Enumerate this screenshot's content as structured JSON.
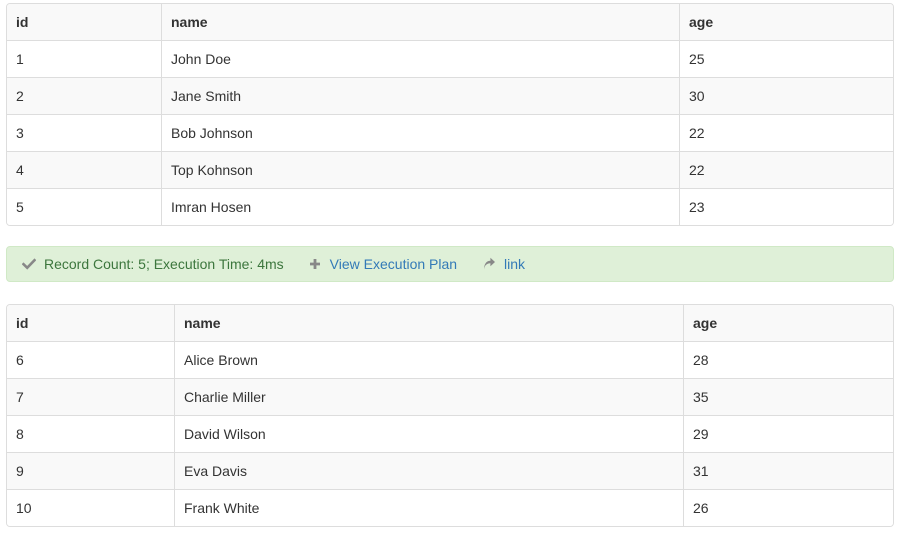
{
  "table1": {
    "columns": [
      "id",
      "name",
      "age"
    ],
    "rows": [
      [
        "1",
        "John Doe",
        "25"
      ],
      [
        "2",
        "Jane Smith",
        "30"
      ],
      [
        "3",
        "Bob Johnson",
        "22"
      ],
      [
        "4",
        "Top Kohnson",
        "22"
      ],
      [
        "5",
        "Imran Hosen",
        "23"
      ]
    ]
  },
  "status": {
    "message": "Record Count: 5; Execution Time: 4ms",
    "execution_plan_label": "View Execution Plan",
    "link_label": "link",
    "icons": [
      "check-icon",
      "plus-icon",
      "share-arrow-icon"
    ],
    "colors": {
      "background": "#dff0d8",
      "text": "#3c763d",
      "link": "#337ab7",
      "icon": "#888888"
    }
  },
  "table2": {
    "columns": [
      "id",
      "name",
      "age"
    ],
    "rows": [
      [
        "6",
        "Alice Brown",
        "28"
      ],
      [
        "7",
        "Charlie Miller",
        "35"
      ],
      [
        "8",
        "David Wilson",
        "29"
      ],
      [
        "9",
        "Eva Davis",
        "31"
      ],
      [
        "10",
        "Frank White",
        "26"
      ]
    ]
  }
}
